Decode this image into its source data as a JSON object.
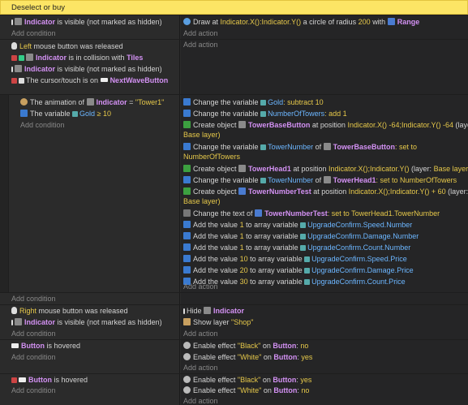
{
  "header": {
    "title": "Deselect or buy"
  },
  "labels": {
    "add_condition": "Add condition",
    "add_action": "Add action"
  },
  "event1": {
    "cond1": {
      "obj": "Indicator",
      "text": "is visible (not marked as hidden)"
    },
    "action1": {
      "pre": "Draw at",
      "pos": "Indicator.X():Indicator.Y()",
      "mid": "a circle of radius",
      "radius": "200",
      "with": "with",
      "obj": "Range"
    }
  },
  "event2": {
    "c1": {
      "button": "Left",
      "text": "mouse button was released"
    },
    "c2": {
      "obj": "Indicator",
      "mid": "is in collision with",
      "obj2": "Tiles"
    },
    "c3": {
      "obj": "Indicator",
      "text": "is visible (not marked as hidden)"
    },
    "c4": {
      "pre": "The cursor/touch is on",
      "obj": "NextWaveButton"
    }
  },
  "event3": {
    "c1": {
      "pre": "The animation of",
      "obj": "Indicator",
      "eq": "=",
      "val": "\"Tower1\""
    },
    "c2": {
      "pre": "The variable",
      "var": "Gold",
      "op": "≥",
      "val": "10"
    },
    "actions": [
      {
        "text": "Change the variable",
        "var": "Gold",
        "rest": ": subtract",
        "val": "10"
      },
      {
        "text": "Change the variable",
        "var": "NumberOfTowers",
        "rest": ": add",
        "val": "1"
      },
      {
        "text": "Create object",
        "obj": "TowerBaseButton",
        "rest": "at position",
        "pos": "Indicator.X() -64;Indicator.Y() -64",
        "layer": "(layer:",
        "layerval": "Base layer)"
      },
      {
        "text": "Change the variable",
        "var": "TowerNumber",
        "of": "of",
        "obj": "TowerBaseButton",
        "rest": ": set to",
        "val": "NumberOfTowers"
      },
      {
        "text": "Create object",
        "obj": "TowerHead1",
        "rest": "at position",
        "pos": "Indicator.X();Indicator.Y()",
        "layer": "(layer:",
        "layerval": "Base layer)"
      },
      {
        "text": "Change the variable",
        "var": "TowerNumber",
        "of": "of",
        "obj": "TowerHead1",
        "rest": ": set to",
        "val": "NumberOfTowers"
      },
      {
        "text": "Create object",
        "obj": "TowerNumberTest",
        "rest": "at position",
        "pos": "Indicator.X();Indicator.Y() + 60",
        "layer": "(layer:",
        "layerval": "Base layer)"
      },
      {
        "text": "Change the text of",
        "obj": "TowerNumberTest",
        "rest": ": set to",
        "val": "TowerHead1.TowerNumber"
      },
      {
        "text": "Add the value",
        "val": "1",
        "rest": "to array variable",
        "var": "UpgradeConfirm.Speed.Number"
      },
      {
        "text": "Add the value",
        "val": "1",
        "rest": "to array variable",
        "var": "UpgradeConfirm.Damage.Number"
      },
      {
        "text": "Add the value",
        "val": "1",
        "rest": "to array variable",
        "var": "UpgradeConfirm.Count.Number"
      },
      {
        "text": "Add the value",
        "val": "10",
        "rest": "to array variable",
        "var": "UpgradeConfirm.Speed.Price"
      },
      {
        "text": "Add the value",
        "val": "20",
        "rest": "to array variable",
        "var": "UpgradeConfirm.Damage.Price"
      },
      {
        "text": "Add the value",
        "val": "30",
        "rest": "to array variable",
        "var": "UpgradeConfirm.Count.Price"
      }
    ]
  },
  "event4": {
    "c1": {
      "button": "Right",
      "text": "mouse button was released"
    },
    "c2": {
      "obj": "Indicator",
      "text": "is visible (not marked as hidden)"
    },
    "a1": {
      "pre": "Hide",
      "obj": "Indicator"
    },
    "a2": {
      "pre": "Show layer",
      "val": "\"Shop\""
    }
  },
  "event5": {
    "c1": {
      "obj": "Button",
      "text": "is hovered"
    },
    "a1": {
      "pre": "Enable effect",
      "eff": "\"Black\"",
      "on": "on",
      "obj": "Button",
      "colon": ":",
      "val": "no"
    },
    "a2": {
      "pre": "Enable effect",
      "eff": "\"White\"",
      "on": "on",
      "obj": "Button",
      "colon": ":",
      "val": "yes"
    }
  },
  "event6": {
    "c1": {
      "obj": "Button",
      "text": "is hovered"
    },
    "a1": {
      "pre": "Enable effect",
      "eff": "\"Black\"",
      "on": "on",
      "obj": "Button",
      "colon": ":",
      "val": "yes"
    },
    "a2": {
      "pre": "Enable effect",
      "eff": "\"White\"",
      "on": "on",
      "obj": "Button",
      "colon": ":",
      "val": "no"
    }
  },
  "colors": {
    "header": "#fce565",
    "object": "#d391f3",
    "variable": "#6cb6ff",
    "value": "#e6c84a"
  }
}
